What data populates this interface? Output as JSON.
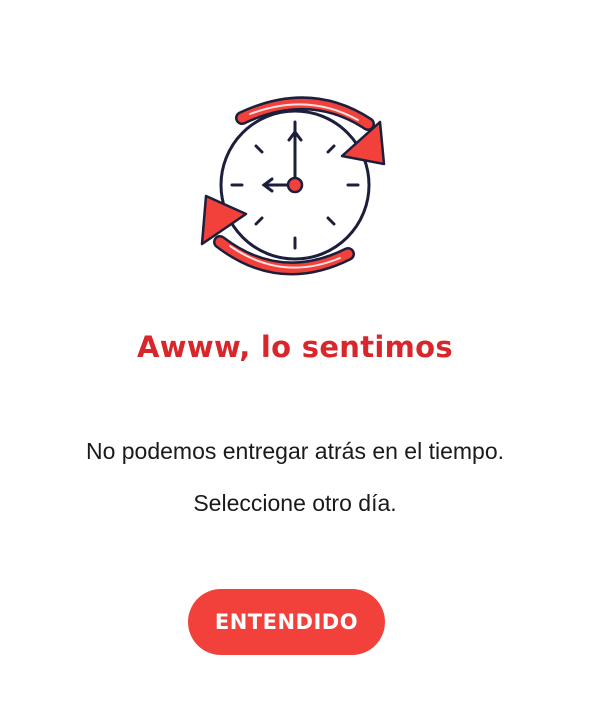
{
  "dialog": {
    "title": "Awww, lo sentimos",
    "message_line1": "No podemos entregar atrás en el tiempo.",
    "message_line2": "Seleccione otro día.",
    "confirm_label": "ENTENDIDO"
  },
  "illustration": {
    "icon": "clock-refresh-icon"
  },
  "colors": {
    "accent": "#f2413b",
    "title": "#d9262b",
    "text": "#1a1a1a",
    "outline": "#1b1f3b",
    "background": "#ffffff"
  }
}
